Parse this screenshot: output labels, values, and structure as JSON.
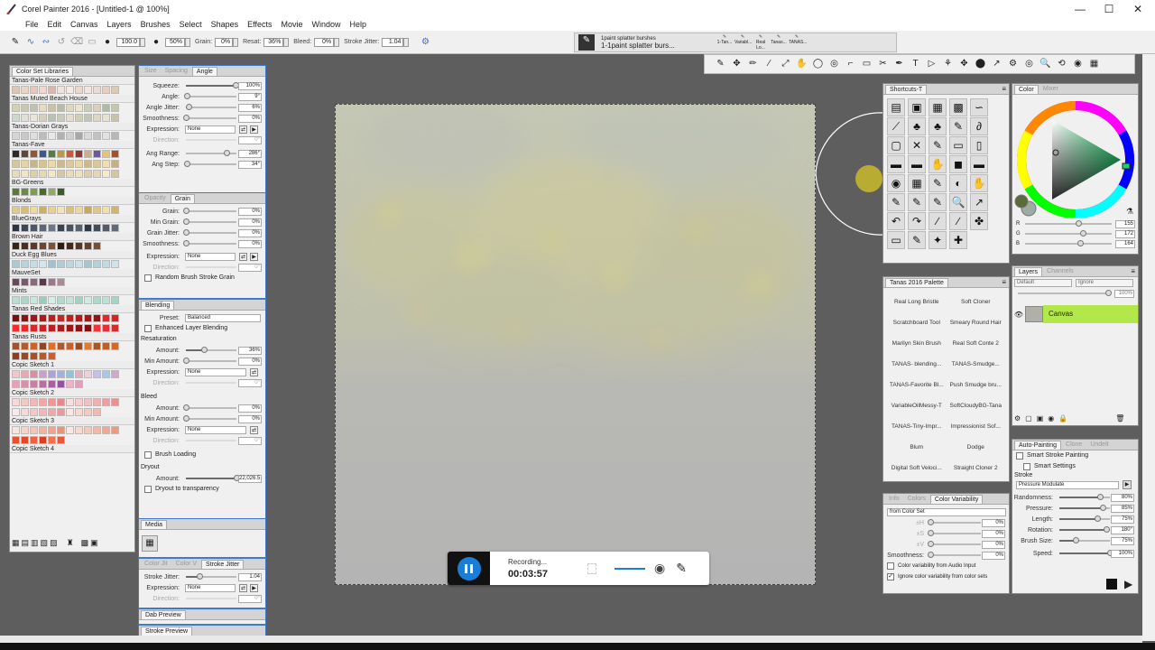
{
  "window": {
    "title": "Corel Painter 2016 - [Untitled-1 @ 100%]",
    "minimize": "—",
    "maximize": "☐",
    "close": "✕"
  },
  "menu": [
    "File",
    "Edit",
    "Canvas",
    "Layers",
    "Brushes",
    "Select",
    "Shapes",
    "Effects",
    "Movie",
    "Window",
    "Help"
  ],
  "propbar": {
    "size": "100.0",
    "opacity": "50%",
    "grain_label": "Grain:",
    "grain": "0%",
    "resat_label": "Resat:",
    "resat": "36%",
    "bleed_label": "Bleed:",
    "bleed": "0%",
    "stroke_jitter_label": "Stroke Jitter:",
    "stroke_jitter": "1.04"
  },
  "recent_brushes": {
    "category": "1paint splatter burshes",
    "variant": "1-1paint splatter burs...",
    "thumbs": [
      "1-Tan...",
      "Variabl...",
      "Real Lo...",
      "Tanas...",
      "TANAS..."
    ]
  },
  "color_set": {
    "tab": "Color Set Libraries",
    "sets": [
      {
        "name": "Tanas-Pale Rose Garden",
        "rows": [
          [
            "#d9c7b8",
            "#e8d6c6",
            "#e4c9c0",
            "#efd8d2",
            "#d7b8b0",
            "#efe3db",
            "#f5ebe4",
            "#e9d9cc",
            "#f3e6de",
            "#eadcd2",
            "#e4cfc3",
            "#dccab9"
          ]
        ]
      },
      {
        "name": "Tanas Muted Beach House",
        "rows": [
          [
            "#d6cfb8",
            "#c9c6b4",
            "#bfc2b2",
            "#e4dcc7",
            "#ccc1a6",
            "#b7bba9",
            "#dfd8c1",
            "#eae4d0",
            "#c9cdb9",
            "#d9d1bd",
            "#aeb9a8",
            "#c3c7b0"
          ],
          [
            "#cfd7c8",
            "#dfe2d3",
            "#e9e6d7",
            "#d4d0bc",
            "#b9c2b2",
            "#c9cbb8",
            "#e3ddca",
            "#d0cdb6",
            "#bfc6b6",
            "#dcd8c5",
            "#e6e2d0",
            "#c8c2ac"
          ]
        ]
      },
      {
        "name": "Tanas-Dorian Grays",
        "rows": [
          [
            "#d5d5d5",
            "#c8c8c8",
            "#dedede",
            "#bcbcbc",
            "#e8e8e8",
            "#b1b1b1",
            "#cfcfcf",
            "#a8a8a8",
            "#d9d9d9",
            "#c2c2c2",
            "#e2e2e2",
            "#b7b7b7"
          ]
        ]
      },
      {
        "name": "Tanas-Fave",
        "rows": [
          [
            "#2a2a2a",
            "#5b4a3a",
            "#8a5a3a",
            "#3a5a8a",
            "#5a7a4a",
            "#b89a4a",
            "#c95a3a",
            "#8a3a3a",
            "#c8b08a",
            "#6a5a9a",
            "#e2c47a",
            "#a0522d"
          ],
          [
            "#d7c69b",
            "#e6d4a8",
            "#c7b58a",
            "#d6c38f",
            "#eed9a6",
            "#cbb98f",
            "#dcc89b",
            "#e9d6a3",
            "#cdb88a",
            "#d9c79b",
            "#f1deb0",
            "#c4b087"
          ],
          [
            "#e8dcb8",
            "#f0e4c4",
            "#dccfaa",
            "#e5d8b4",
            "#f3e7c6",
            "#d5c8a2",
            "#e9ddb9",
            "#efe2bf",
            "#dbcea8",
            "#e4d7b2",
            "#f5eacb",
            "#d3c6a0"
          ]
        ]
      },
      {
        "name": "BG-Greens",
        "rows": [
          [
            "#5a7a3a",
            "#6e8a4a",
            "#809a58",
            "#4a6a32",
            "#93a96a",
            "#3c5a2a"
          ]
        ]
      },
      {
        "name": "Blonds",
        "rows": [
          [
            "#e3c98a",
            "#d9bb73",
            "#f0d9a1",
            "#cfae62",
            "#e8cf94",
            "#f5e3b5",
            "#dbc07c",
            "#eed6a0",
            "#c9a85c",
            "#e1c68b",
            "#f2dfad",
            "#d4b46c"
          ]
        ]
      },
      {
        "name": "BlueGrays",
        "rows": [
          [
            "#2d3640",
            "#3d4854",
            "#4b5867",
            "#5a6877",
            "#6a7888",
            "#3a444f",
            "#48535f",
            "#57626e",
            "#2f3945",
            "#424d59",
            "#515c68",
            "#606b77"
          ]
        ]
      },
      {
        "name": "Brown Hair",
        "rows": [
          [
            "#3a2418",
            "#4a2e1f",
            "#5b3a27",
            "#6b4630",
            "#7c5339",
            "#2e1c12",
            "#44291b",
            "#553524",
            "#65412d",
            "#764e36"
          ]
        ]
      },
      {
        "name": "Duck Egg Blues",
        "rows": [
          [
            "#a9c9d8",
            "#b7d3df",
            "#c5dde6",
            "#d3e6ec",
            "#9fc1d1",
            "#b0ccda",
            "#bed6e0",
            "#cce0e8",
            "#a4c5d4",
            "#b4d0dc",
            "#c1d9e3",
            "#d0e3ea"
          ]
        ]
      },
      {
        "name": "MauveSet",
        "rows": [
          [
            "#6a4a5a",
            "#7a5a6a",
            "#8a6a7a",
            "#5a3a4a",
            "#9a7a8a",
            "#a98a99"
          ]
        ]
      },
      {
        "name": "Mints",
        "rows": [
          [
            "#b8e0d2",
            "#a7d8c8",
            "#c7e8dc",
            "#96cfbd",
            "#d6efe6",
            "#b0dccd",
            "#c0e4d7",
            "#9fd3c2",
            "#cfece1",
            "#abdacb",
            "#bbe2d5",
            "#a2d5c5"
          ]
        ]
      },
      {
        "name": "Tanas Red Shades",
        "rows": [
          [
            "#7a0f10",
            "#8a1414",
            "#9a1818",
            "#aa1c1c",
            "#ba2020",
            "#ca2424",
            "#c41e1e",
            "#b51a1a",
            "#a51616",
            "#951212",
            "#e02a2a",
            "#d02626"
          ],
          [
            "#f03030",
            "#e62c2c",
            "#d82828",
            "#c92424",
            "#ba2020",
            "#ab1c1c",
            "#9c1818",
            "#8d1414",
            "#7e1010",
            "#f23434",
            "#e43030",
            "#d62c2c"
          ]
        ]
      },
      {
        "name": "Tanas Rusts",
        "rows": [
          [
            "#a0522d",
            "#b35c2e",
            "#c6662f",
            "#8d4828",
            "#d97030",
            "#b0582c",
            "#c36230",
            "#964d2a",
            "#e07a38",
            "#a95528",
            "#bc5f2d",
            "#cf6931"
          ],
          [
            "#8a4020",
            "#9a4824",
            "#aa5028",
            "#ba582c",
            "#ca6030"
          ]
        ]
      },
      {
        "name": "Copic Sketch 1",
        "rows": [
          [
            "#f3c6c6",
            "#e8a9b0",
            "#d98fa0",
            "#c9a0c9",
            "#b0a0d9",
            "#a0b0e0",
            "#8fc1e0",
            "#e0b0c0",
            "#f0d0d8",
            "#c0c0e8",
            "#a8c8e8",
            "#d0a8c8"
          ],
          [
            "#e8a0b8",
            "#d890a8",
            "#c880a0",
            "#b870a0",
            "#a860a0",
            "#9850a0",
            "#f0b0c8",
            "#e0a0b8"
          ]
        ]
      },
      {
        "name": "Copic Sketch 2",
        "rows": [
          [
            "#f8d8d8",
            "#f5c8c8",
            "#f2b8b8",
            "#efa8a8",
            "#ec9898",
            "#e98888",
            "#f9e0e0",
            "#f6d0d0",
            "#f3c0c0",
            "#f0b0b0",
            "#eda0a0",
            "#ea9090"
          ],
          [
            "#fbe8e8",
            "#f8d8d8",
            "#f5c8c8",
            "#f2b8b8",
            "#efa8a8",
            "#ec9898",
            "#fce8e0",
            "#f9d8d0",
            "#f6c8c0",
            "#f3b8b0"
          ]
        ]
      },
      {
        "name": "Copic Sketch 3",
        "rows": [
          [
            "#fbe4dc",
            "#f8d4c8",
            "#f5c4b4",
            "#f2b4a0",
            "#efa48c",
            "#ec9478",
            "#fde8e0",
            "#fad8cc",
            "#f7c8b8",
            "#f4b8a4",
            "#f1a890",
            "#ee987c"
          ],
          [
            "#e85030",
            "#e04828",
            "#f06040",
            "#d84020",
            "#f87050",
            "#e85838"
          ]
        ]
      },
      {
        "name": "Copic Sketch 4",
        "rows": []
      }
    ]
  },
  "brush_controls": {
    "angle_tabs": [
      "Size",
      "Spacing",
      "Angle"
    ],
    "angle": [
      {
        "label": "Squeeze:",
        "value": "100%",
        "pos": 0.98
      },
      {
        "label": "Angle:",
        "value": "9°",
        "pos": 0.02
      },
      {
        "label": "Angle Jitter:",
        "value": "6%",
        "pos": 0.06
      },
      {
        "label": "Smoothness:",
        "value": "0%",
        "pos": 0.0
      }
    ],
    "angle_expression_label": "Expression:",
    "angle_expression": "None",
    "angle_direction_label": "Direction:",
    "angle_direction": "0°",
    "angle_range_label": "Ang Range:",
    "angle_range": "286°",
    "angle_range_pos": 0.8,
    "angle_step_label": "Ang Step:",
    "angle_step": "34°",
    "angle_step_pos": 0.02,
    "grain_tabs": [
      "Opacity",
      "Grain"
    ],
    "grain": [
      {
        "label": "Grain:",
        "value": "0%",
        "pos": 0.0
      },
      {
        "label": "Min Grain:",
        "value": "0%",
        "pos": 0.0
      },
      {
        "label": "Grain Jitter:",
        "value": "0%",
        "pos": 0.0
      },
      {
        "label": "Smoothness:",
        "value": "0%",
        "pos": 0.0
      }
    ],
    "grain_expression_label": "Expression:",
    "grain_expression": "None",
    "grain_direction_label": "Direction:",
    "grain_direction": "0°",
    "random_grain": "Random Brush Stroke Grain",
    "blending_tab": "Blending",
    "preset_label": "Preset:",
    "preset": "Balanced",
    "enhanced_blending": "Enhanced Layer Blending",
    "resaturation_label": "Resaturation",
    "resat_amount_label": "Amount:",
    "resat_amount": "36%",
    "resat_amount_pos": 0.36,
    "resat_min_label": "Min Amount:",
    "resat_min": "0%",
    "resat_expression_label": "Expression:",
    "resat_expression": "None",
    "resat_direction_label": "Direction:",
    "resat_direction": "0°",
    "bleed_label": "Bleed",
    "bleed_amount_label": "Amount:",
    "bleed_amount": "0%",
    "bleed_min_label": "Min Amount:",
    "bleed_min": "0%",
    "bleed_expression_label": "Expression:",
    "bleed_expression": "None",
    "bleed_direction_label": "Direction:",
    "bleed_direction": "0°",
    "brush_loading": "Brush Loading",
    "dryout_label": "Dryout",
    "dryout_amount_label": "Amount:",
    "dryout_amount": "22,026.5",
    "dryout_amount_pos": 1.0,
    "dryout_transparency": "Dryout to transparency",
    "media_tab": "Media",
    "jitter_tabs": [
      "Color Jit",
      "Color V",
      "Stroke Jitter"
    ],
    "stroke_jitter_label": "Stroke Jitter:",
    "stroke_jitter": "1.04",
    "stroke_jitter_pos": 0.26,
    "jitter_expression_label": "Expression:",
    "jitter_expression": "None",
    "jitter_direction_label": "Direction:",
    "jitter_direction": "0°",
    "dab_preview": "Dab Preview",
    "stroke_preview": "Stroke Preview"
  },
  "toolbox": [
    "✎",
    "✥",
    "✏",
    "∕",
    "⤢",
    "✋",
    "◯",
    "◎",
    "⌐",
    "▭",
    "✂",
    "✒",
    "T",
    "▷",
    "⚘",
    "✥",
    "⬤",
    "↗",
    "⚙",
    "◎",
    "🔍",
    "⟲",
    "◉",
    "▦"
  ],
  "shortcuts": {
    "tab": "Shortcuts-T",
    "buttons": [
      "▤",
      "▣",
      "▦",
      "▩",
      "∽",
      "⟋",
      "♣",
      "♣",
      "✎",
      "∂",
      "▢",
      "✕",
      "✎",
      "▭",
      "▯",
      "▬",
      "▬",
      "✋",
      "◼",
      "▬",
      "◉",
      "▦",
      "✎",
      "◐",
      "✋",
      "✎",
      "✎",
      "✎",
      "🔍",
      "↗",
      "↶",
      "↷",
      "∕",
      "∕",
      "✤",
      "▭",
      "✎",
      "✦",
      "✚"
    ]
  },
  "palette": {
    "tab": "Tanas 2016 Palette",
    "items": [
      "Real Long Bristle",
      "Soft Cloner",
      "Scratchboard Tool",
      "Smeary Round Hair",
      "Marilyn Skin Brush",
      "Real Soft Conte 2",
      "TANAS- blending...",
      "TANAS-Smudge...",
      "TANAS-Favorite Bl...",
      "Push Smudge bru...",
      "VariableOilMessy-T",
      "SoftCloudyBG-Tana",
      "TANAS-Tiny-Impr...",
      "Impressionist Sof...",
      "Blum",
      "Dodge",
      "Digital Soft Veloci...",
      "Straight Cloner 2"
    ]
  },
  "color_panel": {
    "tabs": [
      "Color",
      "Mixer"
    ],
    "r_label": "R",
    "r": "155",
    "r_pos": 0.61,
    "g_label": "G",
    "g": "172",
    "g_pos": 0.67,
    "b_label": "B",
    "b": "164",
    "b_pos": 0.64
  },
  "layers": {
    "tabs": [
      "Layers",
      "Channels"
    ],
    "composite": "Default",
    "ignore": "Ignore",
    "opacity": "100%",
    "layer_name": "Canvas",
    "layer_color": "#b3e84a"
  },
  "color_variability": {
    "tabs": [
      "Info",
      "Colors",
      "Color Variability"
    ],
    "mode": "from Color Set",
    "rows": [
      {
        "label": "±H",
        "value": "0%"
      },
      {
        "label": "±S",
        "value": "0%"
      },
      {
        "label": "±V",
        "value": "0%"
      }
    ],
    "smoothness_label": "Smoothness:",
    "smoothness": "0%",
    "audio": "Color variability from Audio Input",
    "ignore_set": "Ignore color variability from color sets"
  },
  "auto_painting": {
    "tabs": [
      "Auto-Painting",
      "Clone",
      "Undelt"
    ],
    "smart_stroke": "Smart Stroke Painting",
    "smart_settings": "Smart Settings",
    "stroke_label": "Stroke",
    "stroke": "Pressure Modulate",
    "rows": [
      {
        "label": "Randomness:",
        "value": "80%",
        "pos": 0.8
      },
      {
        "label": "Pressure:",
        "value": "85%",
        "pos": 0.85
      },
      {
        "label": "Length:",
        "value": "75%",
        "pos": 0.75
      },
      {
        "label": "Rotation:",
        "value": "180°",
        "pos": 0.92
      },
      {
        "label": "Brush Size:",
        "value": "75%",
        "pos": 0.32
      }
    ],
    "speed_label": "Speed:",
    "speed": "100%"
  },
  "recording": {
    "status": "Recording...",
    "time": "00:03:57"
  }
}
